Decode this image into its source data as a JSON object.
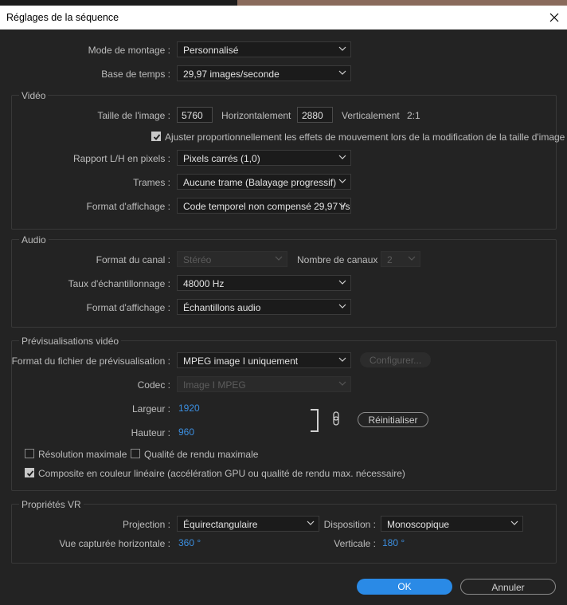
{
  "window": {
    "title": "Réglages de la séquence"
  },
  "editing": {
    "mode_label": "Mode de montage :",
    "mode_value": "Personnalisé",
    "timebase_label": "Base de temps :",
    "timebase_value": "29,97  images/seconde"
  },
  "video": {
    "title": "Vidéo",
    "frame_size_label": "Taille de l'image :",
    "width_value": "5760",
    "horizontal_label": "Horizontalement",
    "height_value": "2880",
    "vertical_label": "Verticalement",
    "ratio": "2:1",
    "scale_effects_label": "Ajuster proportionnellement les effets de mouvement lors de la modification de la taille d'image",
    "scale_effects_checked": true,
    "pixel_aspect_label": "Rapport L/H en pixels :",
    "pixel_aspect_value": "Pixels carrés (1,0)",
    "fields_label": "Trames :",
    "fields_value": "Aucune trame (Balayage progressif)",
    "display_label": "Format d'affichage :",
    "display_value": "Code temporel non compensé 29,97 i/s"
  },
  "audio": {
    "title": "Audio",
    "channel_format_label": "Format du canal :",
    "channel_format_value": "Stéréo",
    "channels_label": "Nombre de canaux :",
    "channels_value": "2",
    "sample_rate_label": "Taux d'échantillonnage :",
    "sample_rate_value": "48000 Hz",
    "display_label": "Format d'affichage :",
    "display_value": "Échantillons audio"
  },
  "preview": {
    "title": "Prévisualisations vidéo",
    "file_format_label": "Format du fichier de prévisualisation :",
    "file_format_value": "MPEG image I uniquement",
    "configure_label": "Configurer...",
    "codec_label": "Codec :",
    "codec_value": "Image I MPEG",
    "width_label": "Largeur :",
    "width_value": "1920",
    "height_label": "Hauteur :",
    "height_value": "960",
    "reset_label": "Réinitialiser",
    "max_res_label": "Résolution maximale",
    "max_res_checked": false,
    "max_quality_label": "Qualité de rendu maximale",
    "max_quality_checked": false,
    "linear_label": "Composite en couleur linéaire (accélération GPU ou qualité de rendu max. nécessaire)",
    "linear_checked": true
  },
  "vr": {
    "title": "Propriétés VR",
    "projection_label": "Projection :",
    "projection_value": "Équirectangulaire",
    "layout_label": "Disposition :",
    "layout_value": "Monoscopique",
    "hfov_label": "Vue capturée horizontale :",
    "hfov_value": "360 °",
    "vfov_label": "Verticale :",
    "vfov_value": "180 °"
  },
  "footer": {
    "ok_label": "OK",
    "cancel_label": "Annuler"
  },
  "colors": {
    "accent": "#2a8ae6",
    "link": "#3c8fe0",
    "background": "#232323"
  }
}
